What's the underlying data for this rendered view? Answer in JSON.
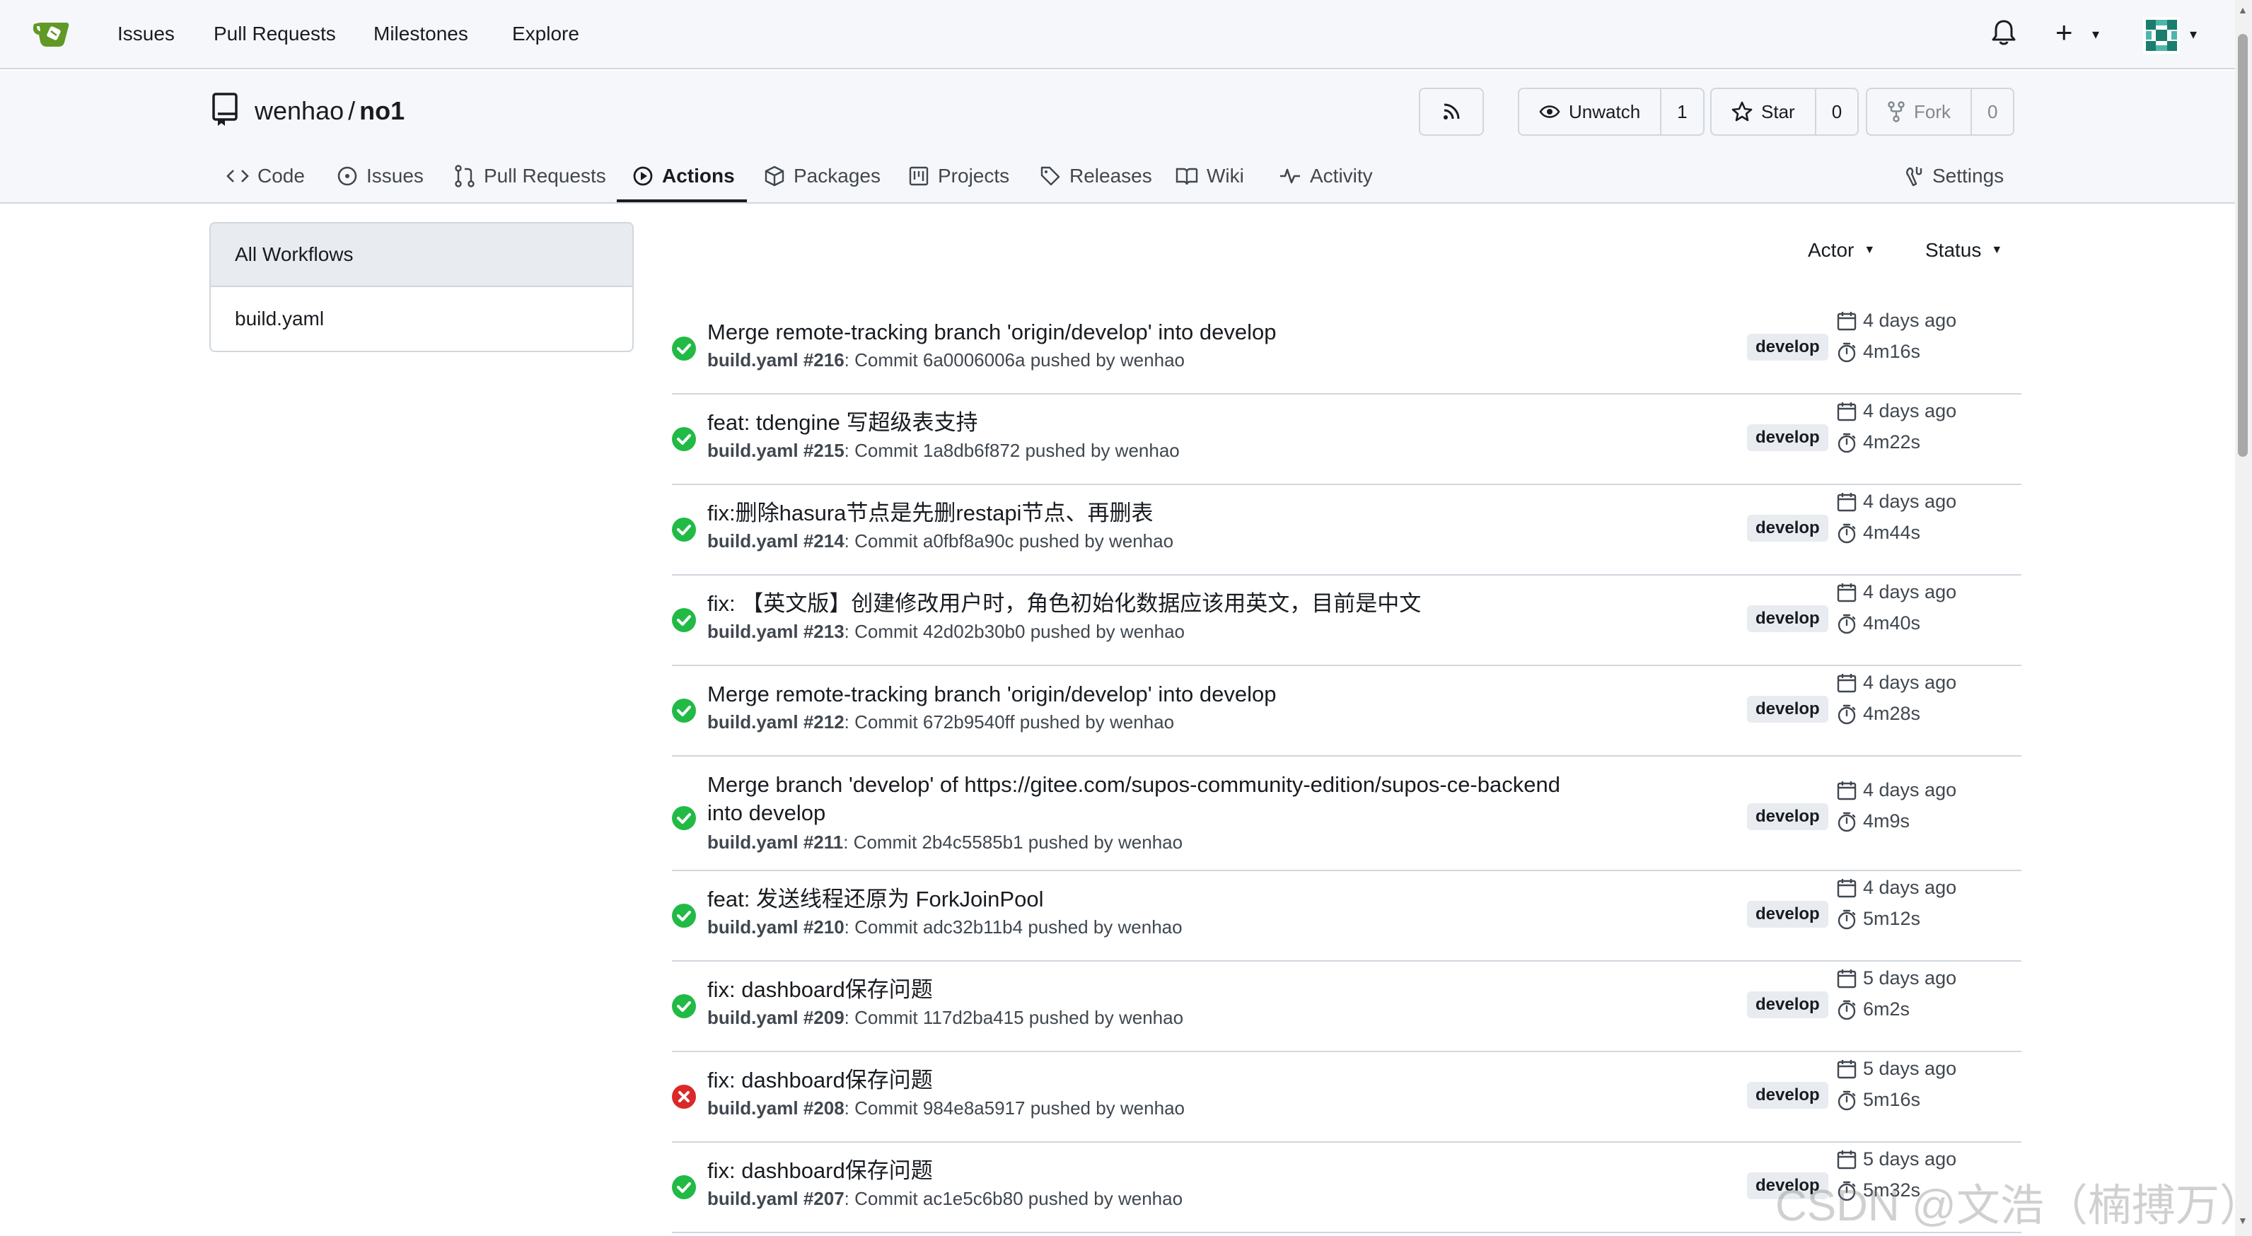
{
  "nav": {
    "links": [
      "Issues",
      "Pull Requests",
      "Milestones",
      "Explore"
    ]
  },
  "repo": {
    "owner": "wenhao",
    "separator": "/",
    "name": "no1",
    "unwatch_label": "Unwatch",
    "watch_count": "1",
    "star_label": "Star",
    "star_count": "0",
    "fork_label": "Fork",
    "fork_count": "0"
  },
  "tabs": [
    {
      "label": "Code",
      "icon": "code-icon"
    },
    {
      "label": "Issues",
      "icon": "issue-icon"
    },
    {
      "label": "Pull Requests",
      "icon": "pull-request-icon"
    },
    {
      "label": "Actions",
      "icon": "play-icon",
      "active": true
    },
    {
      "label": "Packages",
      "icon": "package-icon"
    },
    {
      "label": "Projects",
      "icon": "project-icon"
    },
    {
      "label": "Releases",
      "icon": "tag-icon"
    },
    {
      "label": "Wiki",
      "icon": "book-icon"
    },
    {
      "label": "Activity",
      "icon": "pulse-icon"
    }
  ],
  "settings_label": "Settings",
  "sidebar": {
    "items": [
      {
        "label": "All Workflows",
        "active": true
      },
      {
        "label": "build.yaml",
        "active": false
      }
    ]
  },
  "filters": {
    "actor": "Actor",
    "status": "Status"
  },
  "runs": [
    {
      "title": "Merge remote-tracking branch 'origin/develop' into develop",
      "workflow": "build.yaml",
      "number": "#216",
      "commit_text": ": Commit 6a0006006a pushed by wenhao",
      "branch": "develop",
      "when": "4 days ago",
      "duration": "4m16s",
      "status": "success"
    },
    {
      "title": "feat: tdengine 写超级表支持",
      "workflow": "build.yaml",
      "number": "#215",
      "commit_text": ": Commit 1a8db6f872 pushed by wenhao",
      "branch": "develop",
      "when": "4 days ago",
      "duration": "4m22s",
      "status": "success"
    },
    {
      "title": "fix:删除hasura节点是先删restapi节点、再删表",
      "workflow": "build.yaml",
      "number": "#214",
      "commit_text": ": Commit a0fbf8a90c pushed by wenhao",
      "branch": "develop",
      "when": "4 days ago",
      "duration": "4m44s",
      "status": "success"
    },
    {
      "title": "fix: 【英文版】创建修改用户时，角色初始化数据应该用英文，目前是中文",
      "workflow": "build.yaml",
      "number": "#213",
      "commit_text": ": Commit 42d02b30b0 pushed by wenhao",
      "branch": "develop",
      "when": "4 days ago",
      "duration": "4m40s",
      "status": "success"
    },
    {
      "title": "Merge remote-tracking branch 'origin/develop' into develop",
      "workflow": "build.yaml",
      "number": "#212",
      "commit_text": ": Commit 672b9540ff pushed by wenhao",
      "branch": "develop",
      "when": "4 days ago",
      "duration": "4m28s",
      "status": "success"
    },
    {
      "title": "Merge branch 'develop' of https://gitee.com/supos-community-edition/supos-ce-backend into develop",
      "workflow": "build.yaml",
      "number": "#211",
      "commit_text": ": Commit 2b4c5585b1 pushed by wenhao",
      "branch": "develop",
      "when": "4 days ago",
      "duration": "4m9s",
      "status": "success"
    },
    {
      "title": "feat: 发送线程还原为 ForkJoinPool",
      "workflow": "build.yaml",
      "number": "#210",
      "commit_text": ": Commit adc32b11b4 pushed by wenhao",
      "branch": "develop",
      "when": "4 days ago",
      "duration": "5m12s",
      "status": "success"
    },
    {
      "title": "fix: dashboard保存问题",
      "workflow": "build.yaml",
      "number": "#209",
      "commit_text": ": Commit 117d2ba415 pushed by wenhao",
      "branch": "develop",
      "when": "5 days ago",
      "duration": "6m2s",
      "status": "success"
    },
    {
      "title": "fix: dashboard保存问题",
      "workflow": "build.yaml",
      "number": "#208",
      "commit_text": ": Commit 984e8a5917 pushed by wenhao",
      "branch": "develop",
      "when": "5 days ago",
      "duration": "5m16s",
      "status": "failure"
    },
    {
      "title": "fix: dashboard保存问题",
      "workflow": "build.yaml",
      "number": "#207",
      "commit_text": ": Commit ac1e5c6b80 pushed by wenhao",
      "branch": "develop",
      "when": "5 days ago",
      "duration": "5m32s",
      "status": "success"
    }
  ],
  "colors": {
    "success": "#21ba45",
    "failure": "#db2828"
  },
  "watermark": "CSDN @文浩（楠搏万）"
}
